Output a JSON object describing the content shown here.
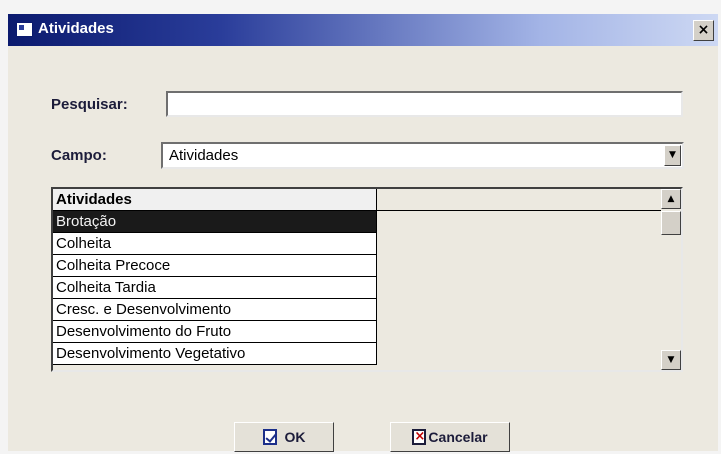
{
  "window": {
    "title": "Atividades",
    "close_glyph": "×"
  },
  "form": {
    "search_label": "Pesquisar:",
    "search_value": "",
    "field_label": "Campo:",
    "field_value": "Atividades"
  },
  "grid": {
    "column_header": "Atividades",
    "rows": [
      "Brotação",
      "Colheita",
      "Colheita Precoce",
      "Colheita Tardia",
      "Cresc. e Desenvolvimento",
      "Desenvolvimento do Fruto",
      "Desenvolvimento Vegetativo"
    ],
    "selected_index": 0
  },
  "buttons": {
    "ok_label": "OK",
    "cancel_label": "Cancelar"
  },
  "icons": {
    "app": "window-icon",
    "ok": "check-document-icon",
    "cancel": "cross-document-icon"
  },
  "colors": {
    "title_bar_start": "#0b1a6e",
    "title_bar_end": "#cdd8f3",
    "selection": "#1a1a1a"
  }
}
